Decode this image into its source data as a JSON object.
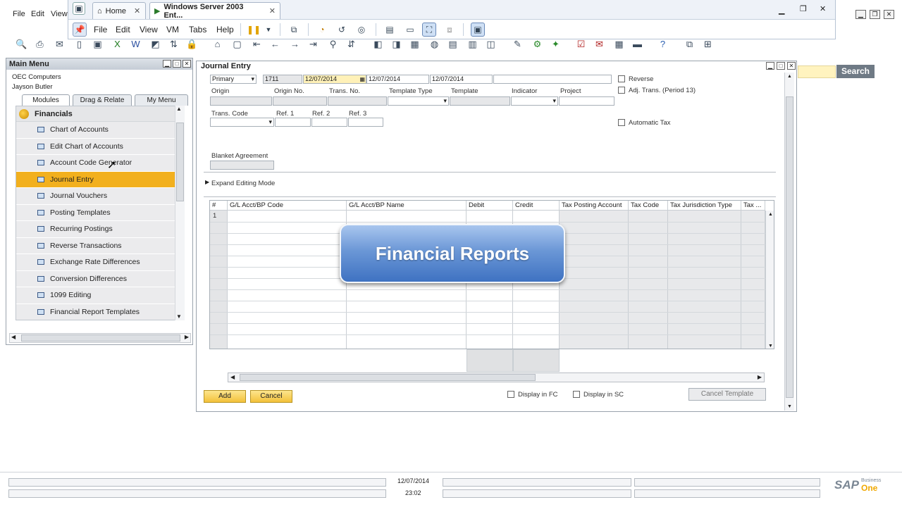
{
  "sap_menu": {
    "items": [
      "File",
      "Edit",
      "View"
    ]
  },
  "vm": {
    "tabs": [
      {
        "label": "Home"
      },
      {
        "label": "Windows Server 2003 Ent..."
      }
    ],
    "menu": [
      "File",
      "Edit",
      "View",
      "VM",
      "Tabs",
      "Help"
    ]
  },
  "search": {
    "button_label": "Search"
  },
  "main_menu": {
    "title": "Main Menu",
    "company": "OEC Computers",
    "user": "Jayson Butler",
    "tabs": [
      "Modules",
      "Drag & Relate",
      "My Menu"
    ],
    "module_header": "Financials",
    "items": [
      {
        "label": "Chart of Accounts"
      },
      {
        "label": "Edit Chart of Accounts"
      },
      {
        "label": "Account Code Generator"
      },
      {
        "label": "Journal Entry"
      },
      {
        "label": "Journal Vouchers"
      },
      {
        "label": "Posting Templates"
      },
      {
        "label": "Recurring Postings"
      },
      {
        "label": "Reverse Transactions"
      },
      {
        "label": "Exchange Rate Differences"
      },
      {
        "label": "Conversion Differences"
      },
      {
        "label": "1099 Editing"
      },
      {
        "label": "Financial Report Templates"
      }
    ],
    "selected_item": "Journal Entry"
  },
  "journal_entry": {
    "title": "Journal Entry",
    "series": "Primary",
    "number": "1711",
    "posting_date": "12/07/2014",
    "due_date": "12/07/2014",
    "doc_date": "12/07/2014",
    "labels": {
      "origin": "Origin",
      "origin_no": "Origin No.",
      "trans_no": "Trans. No.",
      "template_type": "Template Type",
      "template": "Template",
      "indicator": "Indicator",
      "project": "Project",
      "trans_code": "Trans. Code",
      "ref1": "Ref. 1",
      "ref2": "Ref. 2",
      "ref3": "Ref. 3",
      "blanket_agreement": "Blanket Agreement",
      "expand_editing_mode": "Expand Editing Mode"
    },
    "checkboxes": {
      "reverse": "Reverse",
      "adj_trans": "Adj. Trans. (Period 13)",
      "automatic_tax": "Automatic Tax",
      "display_fc": "Display in FC",
      "display_sc": "Display in SC"
    },
    "grid_columns": [
      "#",
      "G/L Acct/BP Code",
      "G/L Acct/BP Name",
      "Debit",
      "Credit",
      "Tax Posting Account",
      "Tax Code",
      "Tax Jurisdiction Type",
      "Tax ..."
    ],
    "first_row_number": "1",
    "buttons": {
      "add": "Add",
      "cancel": "Cancel",
      "cancel_template": "Cancel Template"
    }
  },
  "overlay": {
    "text": "Financial Reports"
  },
  "status_bar": {
    "date": "12/07/2014",
    "time": "23:02",
    "brand": "SAP",
    "product_line1": "Business",
    "product_line2": "One"
  },
  "colors": {
    "selected_item": "#f2b01e",
    "overlay_blue": "#4f7fca",
    "search_field": "#fff3bf"
  }
}
